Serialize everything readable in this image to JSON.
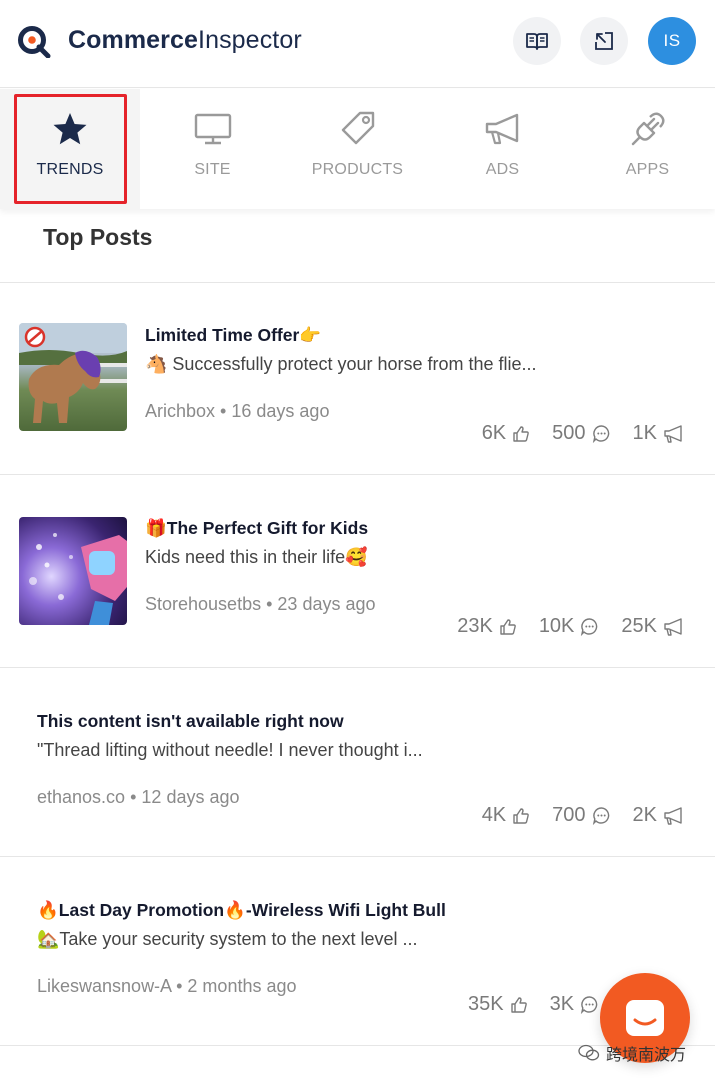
{
  "header": {
    "brand_bold": "Commerce",
    "brand_light": "Inspector",
    "avatar_initials": "IS",
    "docs_icon": "book-icon",
    "external_icon": "external-link-icon"
  },
  "tabs": [
    {
      "label": "TRENDS",
      "icon": "star-icon",
      "active": true
    },
    {
      "label": "SITE",
      "icon": "monitor-icon",
      "active": false
    },
    {
      "label": "PRODUCTS",
      "icon": "tag-icon",
      "active": false
    },
    {
      "label": "ADS",
      "icon": "megaphone-icon",
      "active": false
    },
    {
      "label": "APPS",
      "icon": "plug-icon",
      "active": false
    }
  ],
  "section": {
    "title": "Top Posts"
  },
  "posts": [
    {
      "title": "Limited Time Offer👉",
      "description": "🐴 Successfully protect your horse from the flie...",
      "source": "Arichbox",
      "age": "16 days ago",
      "likes": "6K",
      "comments": "500",
      "shares": "1K",
      "has_thumbnail": true
    },
    {
      "title": "🎁The Perfect Gift for Kids",
      "description": "Kids need this in their life🥰",
      "source": "Storehousetbs",
      "age": "23 days ago",
      "likes": "23K",
      "comments": "10K",
      "shares": "25K",
      "has_thumbnail": true
    },
    {
      "title": "This content isn't available right now",
      "description": "\"Thread lifting without needle! I never thought i...",
      "source": "ethanos.co",
      "age": "12 days ago",
      "likes": "4K",
      "comments": "700",
      "shares": "2K",
      "has_thumbnail": false
    },
    {
      "title": "🔥Last Day Promotion🔥-Wireless Wifi Light Bull",
      "description": "🏡Take your security system to the next level ...",
      "source": "Likeswansnow-A",
      "age": "2 months ago",
      "likes": "35K",
      "comments": "3K",
      "shares": "",
      "has_thumbnail": false
    }
  ],
  "separator": "•",
  "watermark": "跨境南波万",
  "colors": {
    "brand_navy": "#1b2a4a",
    "avatar_blue": "#2d8fe0",
    "highlight_red": "#e5232a",
    "chat_orange": "#f25a22"
  }
}
